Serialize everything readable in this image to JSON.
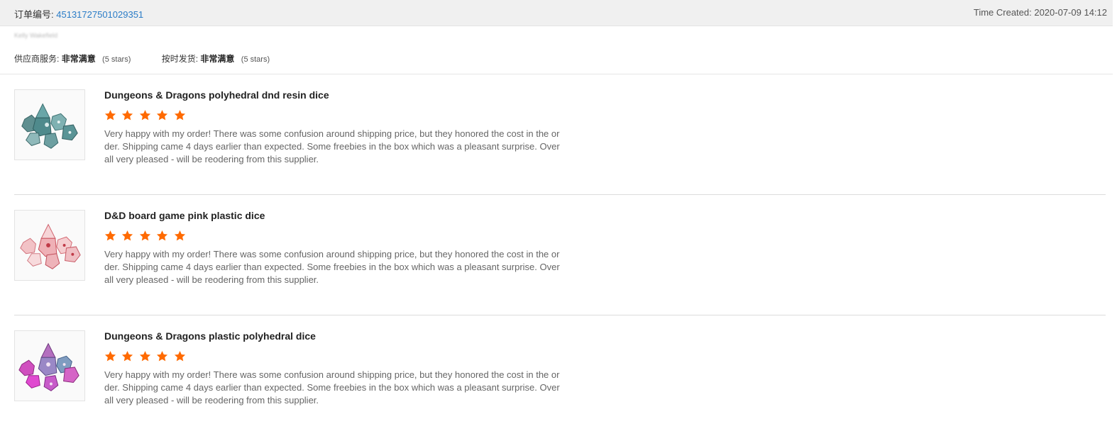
{
  "order": {
    "label": "订单编号:",
    "number": "45131727501029351",
    "time_created": "Time Created: 2020-07-09 14:12"
  },
  "buyer": {
    "name": "Kelly Wakefield"
  },
  "supplier_ratings": [
    {
      "label": "供应商服务:",
      "value": "非常满意",
      "stars_text": "(5 stars)"
    },
    {
      "label": "按时发货:",
      "value": "非常满意",
      "stars_text": "(5 stars)"
    }
  ],
  "colors": {
    "star": "#ff6a00",
    "order_number": "#2a7cc7",
    "header_bg": "#f0f0f0"
  },
  "reviews": [
    {
      "title": "Dungeons & Dragons polyhedral dnd resin dice",
      "rating": 5,
      "text": "Very happy with my order! There was some confusion around shipping price, but they honored the cost in the order. Shipping came 4 days earlier than expected. Some freebies in the box which was a pleasant surprise. Overall very pleased - will be reodering from this supplier.",
      "image": "teal-dice-image"
    },
    {
      "title": "D&D board game pink plastic dice",
      "rating": 5,
      "text": "Very happy with my order! There was some confusion around shipping price, but they honored the cost in the order. Shipping came 4 days earlier than expected. Some freebies in the box which was a pleasant surprise. Overall very pleased - will be reodering from this supplier.",
      "image": "pink-dice-image"
    },
    {
      "title": "Dungeons & Dragons plastic polyhedral dice",
      "rating": 5,
      "text": "Very happy with my order! There was some confusion around shipping price, but they honored the cost in the order. Shipping came 4 days earlier than expected. Some freebies in the box which was a pleasant surprise. Overall very pleased - will be reodering from this supplier.",
      "image": "magenta-dice-image"
    }
  ]
}
